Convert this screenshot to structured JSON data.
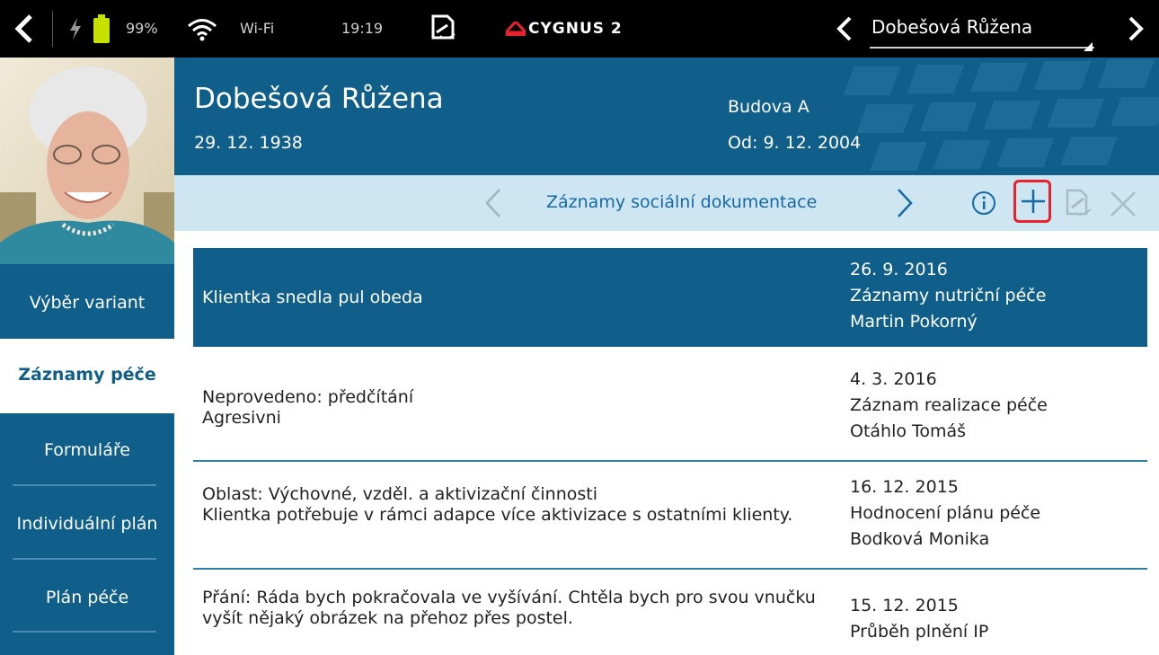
{
  "statusbar": {
    "battery": "99%",
    "wifi_label": "Wi-Fi",
    "time": "19:19",
    "brand": "CYGNUS 2",
    "client_select": "Dobešová Růžena"
  },
  "colors": {
    "primary": "#0f5f8a",
    "toolbar_bg": "#cde6f1",
    "highlight_border": "#e8212a",
    "icon_blue": "#1769a6"
  },
  "sidebar": {
    "items": [
      {
        "label": "Výběr variant"
      },
      {
        "label": "Záznamy péče"
      },
      {
        "label": "Formuláře"
      },
      {
        "label": "Individuální plán"
      },
      {
        "label": "Plán péče"
      }
    ]
  },
  "client": {
    "name": "Dobešová Růžena",
    "birthdate": "29. 12. 1938",
    "building": "Budova A",
    "since": "Od: 9. 12. 2004"
  },
  "toolbar": {
    "title": "Záznamy sociální dokumentace"
  },
  "records": [
    {
      "text": [
        "Klientka snedla pul obeda"
      ],
      "date": "26. 9. 2016",
      "type": "Záznamy nutriční péče",
      "author": "Martin Pokorný"
    },
    {
      "text": [
        "Neprovedeno: předčítání",
        "Agresivni"
      ],
      "date": "4. 3. 2016",
      "type": "Záznam realizace péče",
      "author": "Otáhlo Tomáš"
    },
    {
      "text": [
        "Oblast: Výchovné, vzděl. a aktivizační činnosti",
        "Klientka potřebuje v rámci adapce více aktivizace s ostatními klienty."
      ],
      "date": "16. 12. 2015",
      "type": "Hodnocení plánu péče",
      "author": "Bodková Monika"
    },
    {
      "text": [
        "Přání: Ráda bych pokračovala ve vyšívání. Chtěla bych pro svou vnučku vyšít nějaký obrázek na přehoz přes postel."
      ],
      "date": "15. 12. 2015",
      "type": "Průběh plnění IP",
      "author": ""
    }
  ]
}
